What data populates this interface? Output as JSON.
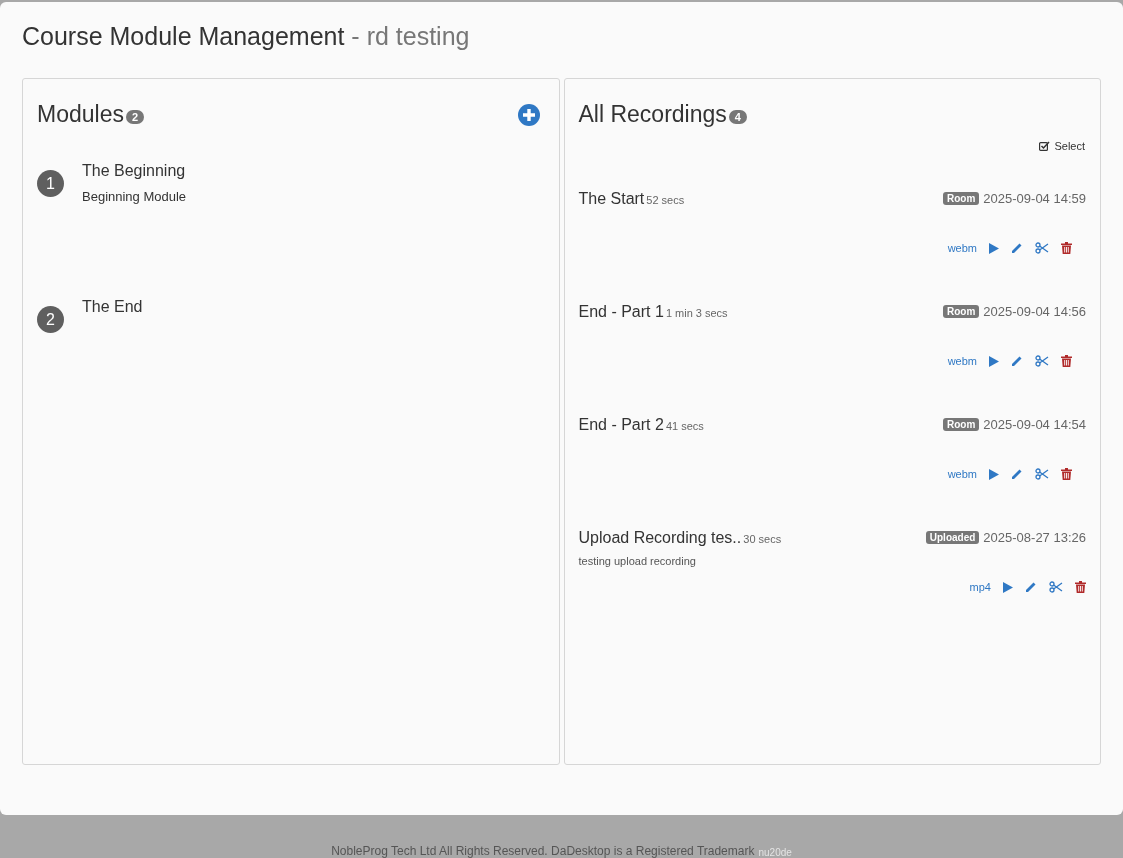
{
  "page_title": {
    "title": "Course Module Management",
    "subtitle": "- rd testing"
  },
  "modules": {
    "heading": "Modules",
    "count": "2",
    "items": [
      {
        "number": "1",
        "title": "The Beginning",
        "description": "Beginning Module"
      },
      {
        "number": "2",
        "title": "The End"
      }
    ]
  },
  "recordings": {
    "heading": "All Recordings",
    "count": "4",
    "select_label": "Select",
    "items": [
      {
        "title": "The Start",
        "duration": "52 secs",
        "source": "Room",
        "date": "2025-09-04 14:59",
        "format": "webm"
      },
      {
        "title": "End - Part 1",
        "duration": "1 min 3 secs",
        "source": "Room",
        "date": "2025-09-04 14:56",
        "format": "webm"
      },
      {
        "title": "End - Part 2",
        "duration": "41 secs",
        "source": "Room",
        "date": "2025-09-04 14:54",
        "format": "webm"
      },
      {
        "title": "Upload Recording tes..",
        "duration": "30 secs",
        "source": "Uploaded",
        "date": "2025-08-27 13:26",
        "description": "testing upload recording",
        "format": "mp4"
      }
    ]
  },
  "footer": {
    "text": "NobleProg Tech Ltd All Rights Reserved. DaDesktop is a Registered Trademark",
    "version": "nu20de"
  }
}
